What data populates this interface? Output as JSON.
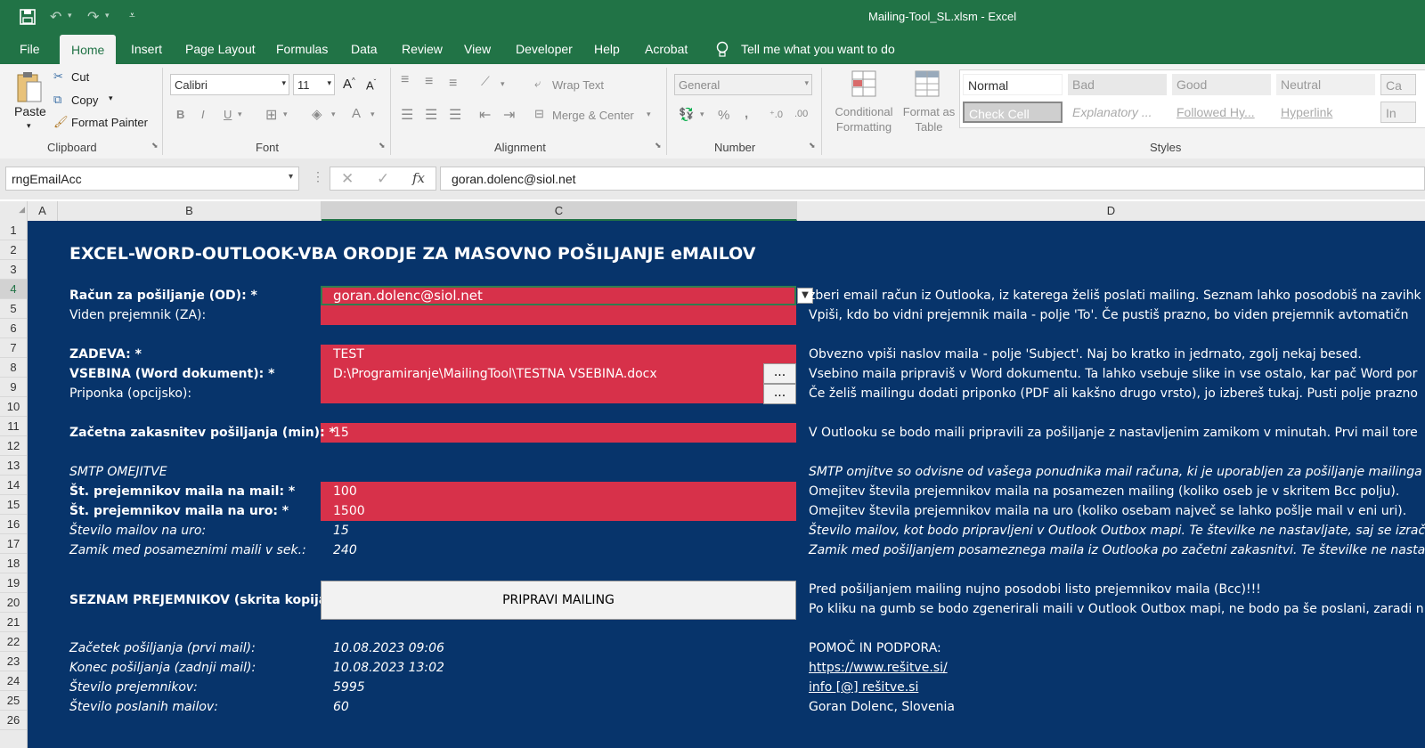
{
  "window": {
    "title": "Mailing-Tool_SL.xlsm  -  Excel"
  },
  "tabs": [
    "File",
    "Home",
    "Insert",
    "Page Layout",
    "Formulas",
    "Data",
    "Review",
    "View",
    "Developer",
    "Help",
    "Acrobat"
  ],
  "tell_me": "Tell me what you want to do",
  "ribbon": {
    "clipboard": {
      "paste": "Paste",
      "cut": "Cut",
      "copy": "Copy",
      "format_painter": "Format Painter",
      "label": "Clipboard"
    },
    "font": {
      "name": "Calibri",
      "size": "11",
      "bold": "B",
      "italic": "I",
      "underline": "U",
      "label": "Font"
    },
    "alignment": {
      "wrap_text": "Wrap Text",
      "merge_center": "Merge & Center",
      "label": "Alignment"
    },
    "number": {
      "format": "General",
      "percent": "%",
      "comma": ",",
      "label": "Number"
    },
    "styles": {
      "conditional": "Conditional Formatting",
      "format_table": "Format as Table",
      "cells": [
        "Normal",
        "Bad",
        "Good",
        "Neutral",
        "Ca",
        "Check Cell",
        "Explanatory ...",
        "Followed Hy...",
        "Hyperlink",
        "In"
      ],
      "label": "Styles"
    }
  },
  "formula_bar": {
    "name_box": "rngEmailAcc",
    "formula": "goran.dolenc@siol.net"
  },
  "columns": [
    "A",
    "B",
    "C",
    "D"
  ],
  "rows": [
    "1",
    "2",
    "3",
    "4",
    "5",
    "6",
    "7",
    "8",
    "9",
    "10",
    "11",
    "12",
    "13",
    "14",
    "15",
    "16",
    "17",
    "18",
    "19",
    "20",
    "21",
    "22",
    "23",
    "24",
    "25",
    "26"
  ],
  "sheet": {
    "title": "EXCEL-WORD-OUTLOOK-VBA ORODJE ZA MASOVNO POŠILJANJE eMAILOV",
    "labels": {
      "r4": "Račun za pošiljanje (OD): *",
      "r5": "Viden prejemnik (ZA):",
      "r7": "ZADEVA: *",
      "r8": "VSEBINA (Word dokument): *",
      "r9": "Priponka (opcijsko):",
      "r11": "Začetna zakasnitev pošiljanja (min): *",
      "r13": "SMTP OMEJITVE",
      "r14": "Št. prejemnikov maila na mail: *",
      "r15": "Št. prejemnikov maila na uro: *",
      "r16": "Število mailov na uro:",
      "r17": "Zamik med posameznimi maili v sek.:",
      "r19": "SEZNAM PREJEMNIKOV (skrita kopija): *",
      "r22": "Začetek pošiljanja (prvi mail):",
      "r23": "Konec pošiljanja (zadnji mail):",
      "r24": "Število prejemnikov:",
      "r25": "Število poslanih mailov:"
    },
    "values": {
      "r4": "goran.dolenc@siol.net",
      "r7": "TEST",
      "r8": "D:\\Programiranje\\MailingTool\\TESTNA VSEBINA.docx",
      "r11": "15",
      "r14": "100",
      "r15": "1500",
      "r16": "15",
      "r17": "240",
      "r22": "10.08.2023 09:06",
      "r23": "10.08.2023 13:02",
      "r24": "5995",
      "r25": "60"
    },
    "browse_button": "...",
    "prepare_button": "PRIPRAVI MAILING",
    "notes": {
      "r4": "zberi email račun iz Outlooka, iz katerega želiš poslati mailing. Seznam lahko posodobiš na zavihk",
      "r5": "Vpiši, kdo bo vidni prejemnik maila - polje 'To'. Če pustiš prazno, bo viden prejemnik avtomatičn",
      "r7": "Obvezno vpiši naslov maila - polje 'Subject'. Naj bo kratko in jedrnato, zgolj nekaj besed.",
      "r8": "Vsebino maila pripraviš v Word dokumentu. Ta lahko vsebuje slike in vse ostalo, kar pač Word por",
      "r9": "Če želiš mailingu dodati priponko (PDF ali kakšno drugo vrsto), jo izbereš tukaj. Pusti polje prazno",
      "r11": "V Outlooku se bodo maili pripravili za pošiljanje z nastavljenim zamikom v minutah. Prvi mail tore",
      "r13": "SMTP omjitve so odvisne od vašega ponudnika mail računa, ki je uporabljen za pošiljanje mailinga",
      "r14": "Omejitev števila prejemnikov maila na posamezen mailing (koliko oseb je v skritem Bcc polju).",
      "r15": "Omejitev števila prejemnikov maila na uro (koliko osebam največ se lahko pošlje mail v eni uri).",
      "r16": "Število mailov, kot bodo pripravljeni v Outlook Outbox mapi. Te številke ne nastavljate, saj se izrač",
      "r17": "Zamik med pošiljanjem posameznega maila iz Outlooka po začetni zakasnitvi. Te številke ne nastav",
      "r19": "Pred pošiljanjem mailing nujno posodobi listo prejemnikov maila (Bcc)!!!",
      "r20": "Po kliku na gumb se bodo zgenerirali maili v Outlook Outbox mapi, ne bodo pa še poslani, zaradi n",
      "r22": "POMOČ IN PODPORA:",
      "r23": "https://www.rešitve.si/",
      "r24": "info [@] rešitve.si",
      "r25": "Goran Dolenc, Slovenia"
    }
  },
  "colors": {
    "brand": "#217346",
    "sheet_bg": "#07346b",
    "input_red": "#d7314a"
  }
}
